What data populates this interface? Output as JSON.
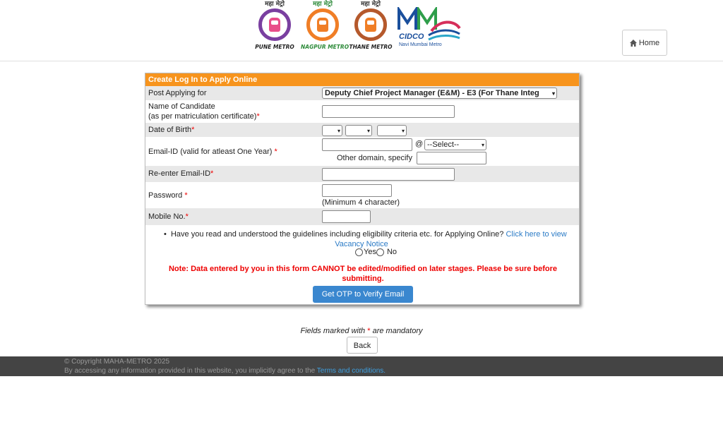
{
  "header": {
    "logos": [
      {
        "tag": "महा मेट्रो",
        "caption": "PUNE METRO",
        "ring": "#7a3fa0",
        "train": "#e94e8a"
      },
      {
        "tag": "महा मेट्रो",
        "caption": "NAGPUR METRO",
        "ring": "#f07e26",
        "train": "#f07e26"
      },
      {
        "tag": "महा मेट्रो",
        "caption": "THANE METRO",
        "ring": "#b5592c",
        "train": "#f07e26"
      }
    ],
    "cidco": {
      "title": "CIDCO",
      "subtitle": "Navi Mumbai Metro"
    },
    "home_label": "Home"
  },
  "form": {
    "title": "Create Log In to Apply Online",
    "post_label": "Post Applying for",
    "post_value": "Deputy Chief Project Manager (E&M) - E3 (For Thane Integ",
    "name_label_1": "Name of Candidate",
    "name_label_2": "(as per matriculation certificate)",
    "dob_label": "Date of Birth",
    "email_label": "Email-ID (valid for atleast One Year)",
    "at_sign": "@",
    "domain_select": "--Select--",
    "other_domain_label": "Other domain, specify",
    "reemail_label": "Re-enter Email-ID",
    "password_label": "Password",
    "password_hint": "(Minimum 4 character)",
    "mobile_label": "Mobile No.",
    "req": "*",
    "guidelines_text": "Have you read and understood the guidelines including eligibility criteria etc. for Applying Online?",
    "guidelines_link": "Click here to view",
    "vacancy_link": "Vacancy Notice",
    "yes_label": "Yes",
    "no_label": "No",
    "note": "Note: Data entered by you in this form CANNOT be edited/modified on later stages. Please be sure before submitting.",
    "otp_button": "Get OTP to Verify Email"
  },
  "mandatory_text_1": "Fields marked with",
  "mandatory_text_2": "are mandatory",
  "back_label": "Back",
  "footer": {
    "copyright": "© Copyright MAHA-METRO 2025",
    "disclaimer": "By accessing any information provided in this website, you implicitly agree to the",
    "terms_link": "Terms and conditions."
  }
}
